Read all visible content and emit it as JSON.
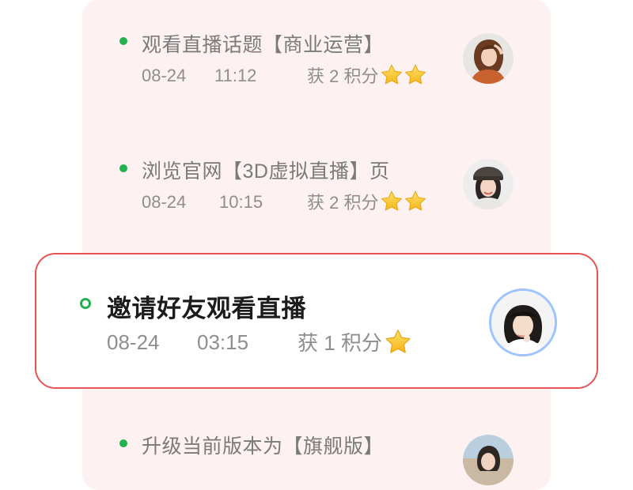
{
  "timeline": {
    "items": [
      {
        "title": "观看直播话题【商业运营】",
        "date": "08-24",
        "time": "11:12",
        "points_text": "获 2 积分",
        "stars": 2,
        "avatar": "woman-brown-hair"
      },
      {
        "title": "浏览官网【3D虚拟直播】页",
        "date": "08-24",
        "time": "10:15",
        "points_text": "获 2 积分",
        "stars": 2,
        "avatar": "woman-cap"
      },
      {
        "title": "邀请好友观看直播",
        "date": "08-24",
        "time": "03:15",
        "points_text": "获 1 积分",
        "stars": 1,
        "avatar": "woman-bob-hair",
        "highlighted": true
      },
      {
        "title": "升级当前版本为【旗舰版】",
        "avatar": "woman-outdoor"
      }
    ]
  },
  "colors": {
    "dot": "#22b14c",
    "highlight_border": "#e45454",
    "panel_bg": "#fdf1f1",
    "avatar_ring": "#9ec3ff"
  }
}
